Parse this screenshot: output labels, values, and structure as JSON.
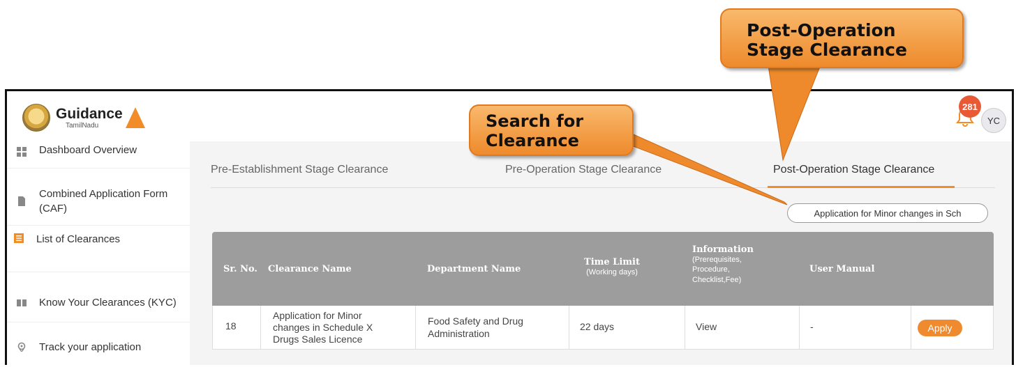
{
  "brand": {
    "name": "Guidance",
    "sub": "TamilNadu"
  },
  "header": {
    "notification_count": "281",
    "avatar_initials": "YC"
  },
  "sidebar": {
    "items": [
      {
        "label": "Dashboard Overview",
        "icon": "grid-icon"
      },
      {
        "label": "Combined Application Form (CAF)",
        "icon": "document-icon"
      },
      {
        "label": "List of Clearances",
        "icon": "list-icon"
      },
      {
        "label": "Know Your Clearances (KYC)",
        "icon": "book-icon"
      },
      {
        "label": "Track your application",
        "icon": "location-pin-icon"
      }
    ]
  },
  "tabs": [
    {
      "label": "Pre-Establishment Stage Clearance"
    },
    {
      "label": "Pre-Operation Stage Clearance"
    },
    {
      "label": "Post-Operation Stage Clearance"
    }
  ],
  "search": {
    "value": "Application for Minor changes in Sch"
  },
  "table": {
    "headers": {
      "sr": "Sr. No.",
      "name": "Clearance Name",
      "dept": "Department Name",
      "time": "Time Limit",
      "time_sub": "(Working days)",
      "info": "Information",
      "info_sub1": "(Prerequisites,",
      "info_sub2": "Procedure,",
      "info_sub3": "Checklist,Fee)",
      "manual": "User Manual"
    },
    "rows": [
      {
        "sr": "18",
        "name1": "Application for Minor",
        "name2": "changes in Schedule X",
        "name3": "Drugs Sales Licence",
        "dept1": "Food Safety and Drug",
        "dept2": "Administration",
        "time": "22 days",
        "info": "View",
        "manual": "-",
        "action": "Apply"
      }
    ]
  },
  "callouts": {
    "post_line1": "Post-Operation",
    "post_line2": "Stage Clearance",
    "search_line1": "Search for",
    "search_line2": "Clearance"
  },
  "colors": {
    "accent": "#F28C28",
    "callout": "#EE8A2C",
    "badge": "#E85A36"
  }
}
